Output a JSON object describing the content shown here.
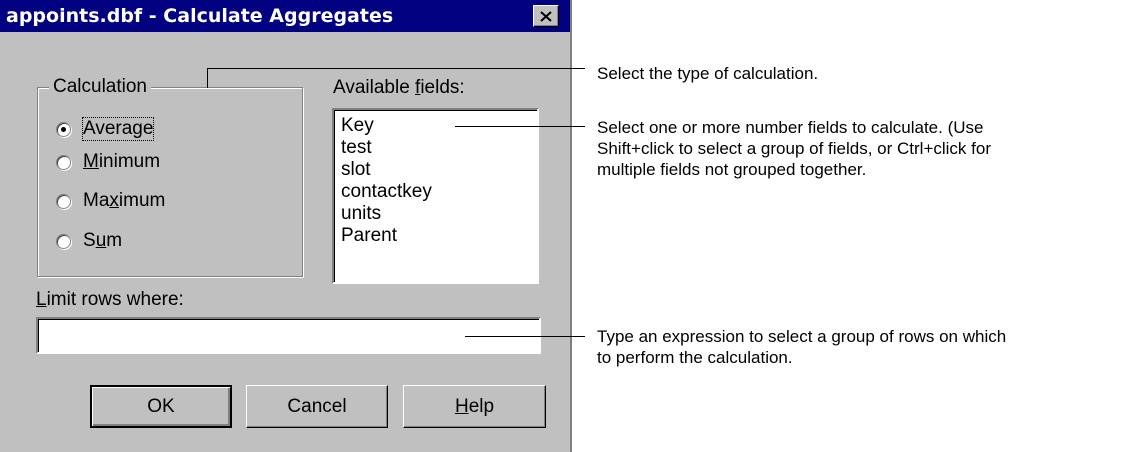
{
  "dialog": {
    "title": "appoints.dbf - Calculate Aggregates",
    "close_glyph": "✕",
    "calculation": {
      "label": "Calculation",
      "options": [
        {
          "label": "Average",
          "checked": true
        },
        {
          "pre": "",
          "key": "M",
          "post": "inimum",
          "checked": false
        },
        {
          "pre": "Ma",
          "key": "x",
          "post": "imum",
          "checked": false
        },
        {
          "pre": "S",
          "key": "u",
          "post": "m",
          "checked": false
        }
      ]
    },
    "fields": {
      "label_pre": "Available ",
      "label_key": "f",
      "label_post": "ields:",
      "items": [
        "Key",
        "test",
        "slot",
        "contactkey",
        "units",
        "Parent"
      ]
    },
    "limit": {
      "label_key": "L",
      "label_post": "imit rows where:",
      "value": ""
    },
    "buttons": {
      "ok": "OK",
      "cancel": "Cancel",
      "help_key": "H",
      "help_post": "elp"
    }
  },
  "annotations": {
    "calculation": "Select the type of calculation.",
    "fields": [
      "Select one or more number fields to calculate. (Use",
      "Shift+click to select a group of fields, or Ctrl+click for",
      "multiple fields not grouped together."
    ],
    "limit": [
      "Type an expression to select a group of rows on which",
      "to perform the calculation."
    ]
  }
}
